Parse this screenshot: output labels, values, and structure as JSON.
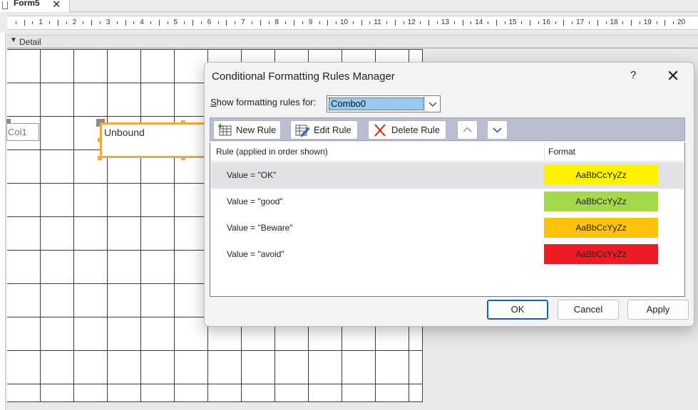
{
  "window": {
    "tab_label": "Form5",
    "tab_close_glyph": "✕"
  },
  "ruler": {
    "numbers": [
      "1",
      "2",
      "3",
      "4",
      "5",
      "6",
      "7",
      "8",
      "9",
      "10",
      "11",
      "12",
      "13",
      "14",
      "15",
      "16",
      "17",
      "18",
      "19",
      "20"
    ]
  },
  "design": {
    "section_label": "Detail",
    "col1_label": "Col1",
    "unbound_label": "Unbound"
  },
  "dialog": {
    "title": "Conditional Formatting Rules Manager",
    "help_glyph": "?",
    "close_glyph": "✕",
    "show_rules_for_label": "Show formatting rules for:",
    "show_rules_for_access_key": "S",
    "selected_control": "Combo0",
    "toolbar": {
      "new_rule": "New Rule",
      "edit_rule": "Edit Rule",
      "delete_rule": "Delete Rule"
    },
    "columns": {
      "rule": "Rule (applied in order shown)",
      "format": "Format"
    },
    "rules": [
      {
        "condition": "Value = \"OK\"",
        "preview": "AaBbCcYyZz",
        "color": "#fff200",
        "selected": true
      },
      {
        "condition": "Value = \"good\"",
        "preview": "AaBbCcYyZz",
        "color": "#a5d84b",
        "selected": false
      },
      {
        "condition": "Value = \"Beware\"",
        "preview": "AaBbCcYyZz",
        "color": "#ffc20e",
        "selected": false
      },
      {
        "condition": "Value = \"avoid\"",
        "preview": "AaBbCcYyZz",
        "color": "#ed1c24",
        "selected": false
      }
    ],
    "buttons": {
      "ok": "OK",
      "cancel": "Cancel",
      "apply": "Apply"
    }
  },
  "colors": {
    "selection_handle": "#f3a640",
    "toolbar_bg": "#b9bfd0",
    "default_button_border": "#1a5fb4"
  }
}
